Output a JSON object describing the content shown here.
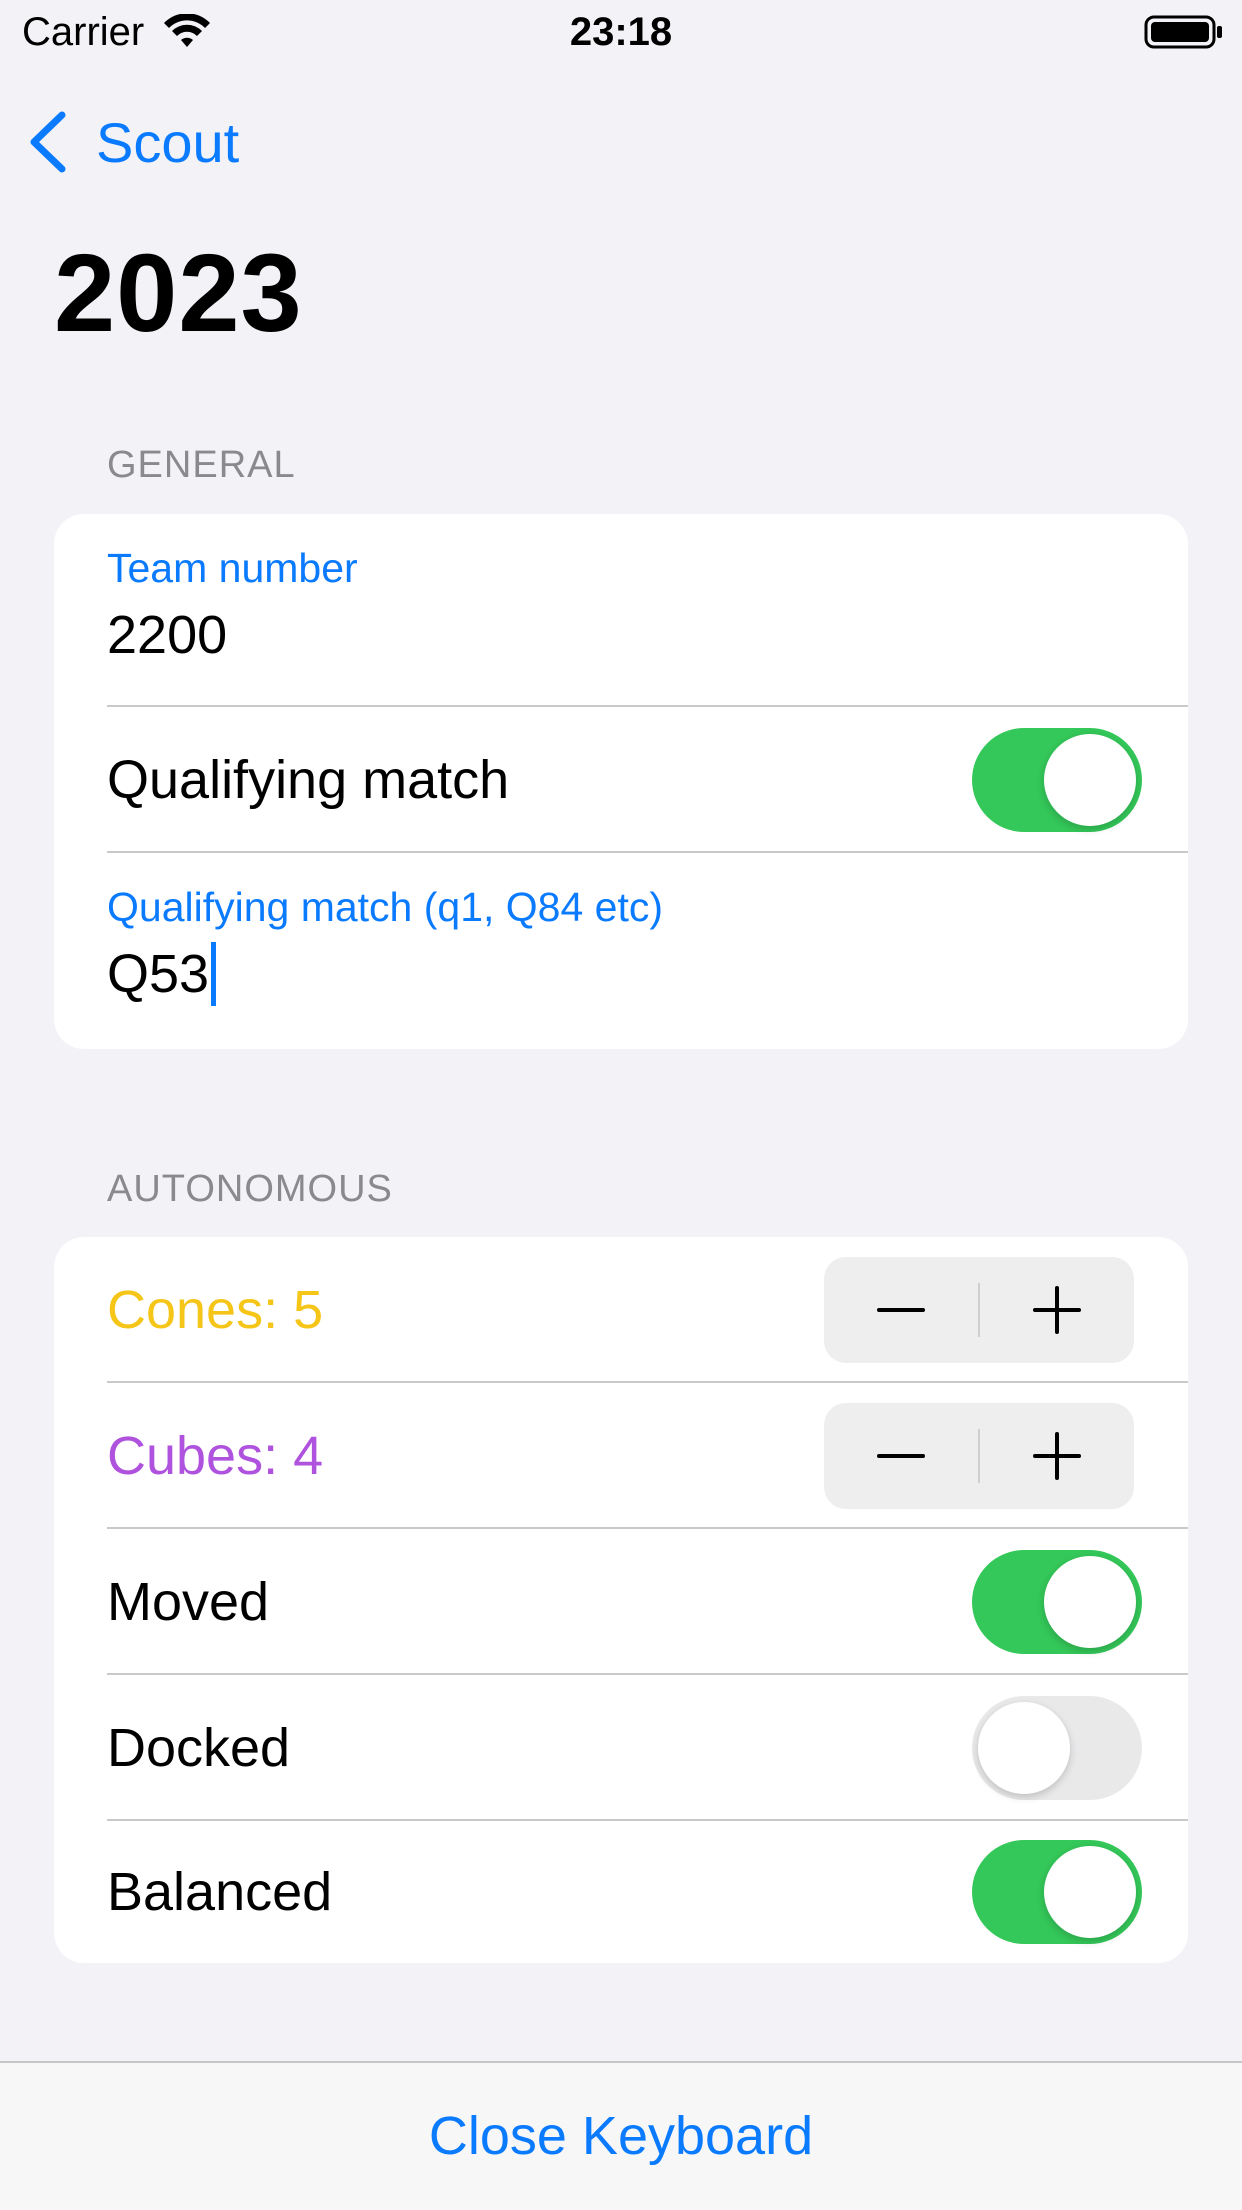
{
  "status_bar": {
    "carrier": "Carrier",
    "time": "23:18"
  },
  "nav": {
    "back_label": "Scout",
    "title": "2023"
  },
  "general": {
    "header": "GENERAL",
    "team_number_label": "Team number",
    "team_number_value": "2200",
    "qualifying_match_label": "Qualifying match",
    "qualifying_match_on": true,
    "qualifying_match_field_label": "Qualifying match (q1, Q84 etc)",
    "qualifying_match_value": "Q53"
  },
  "autonomous": {
    "header": "AUTONOMOUS",
    "cones_label": "Cones: 5",
    "cones_count": 5,
    "cubes_label": "Cubes: 4",
    "cubes_count": 4,
    "moved_label": "Moved",
    "moved_on": true,
    "docked_label": "Docked",
    "docked_on": false,
    "balanced_label": "Balanced",
    "balanced_on": true
  },
  "bottom_bar": {
    "close_keyboard_label": "Close Keyboard"
  },
  "colors": {
    "accent": "#0a7aff",
    "toggle_on": "#34c759",
    "cones": "#f5c518",
    "cubes": "#af52de",
    "background": "#f2f2f7"
  }
}
